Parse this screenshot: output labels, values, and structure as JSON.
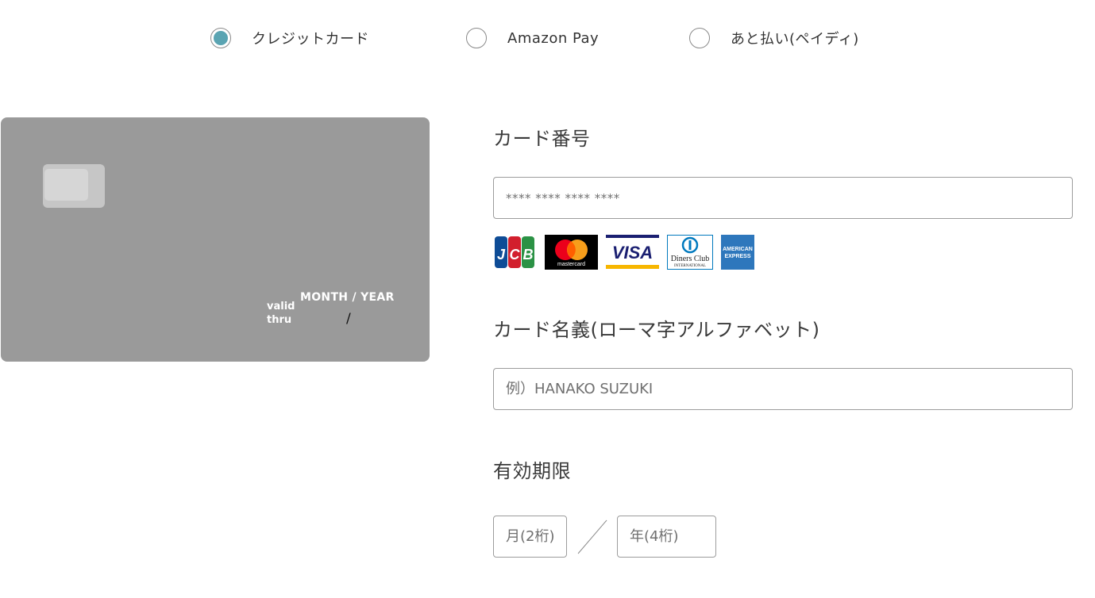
{
  "payment_methods": [
    {
      "label": "クレジットカード",
      "selected": true
    },
    {
      "label": "Amazon Pay",
      "selected": false
    },
    {
      "label": "あと払い(ペイディ)",
      "selected": false
    }
  ],
  "card_preview": {
    "valid_line1": "valid",
    "valid_line2": "thru",
    "expiry_caption": "MONTH / YEAR",
    "expiry_separator": "/"
  },
  "card_number": {
    "label": "カード番号",
    "placeholder": "**** **** **** ****"
  },
  "brands": [
    {
      "name": "JCB",
      "icon": "jcb-logo"
    },
    {
      "name": "mastercard",
      "icon": "mastercard-logo"
    },
    {
      "name": "VISA",
      "icon": "visa-logo"
    },
    {
      "name": "Diners Club",
      "sub": "INTERNATIONAL",
      "icon": "diners-club-logo"
    },
    {
      "name": "AMERICAN",
      "sub": "EXPRESS",
      "icon": "amex-logo"
    }
  ],
  "card_holder": {
    "label": "カード名義(ローマ字アルファベット)",
    "placeholder": "例）HANAKO SUZUKI"
  },
  "expiry": {
    "label": "有効期限",
    "month_placeholder": "月(2桁)",
    "year_placeholder": "年(4桁)"
  },
  "colors": {
    "accent": "#5aa4b2",
    "card_bg": "#9a9a9a",
    "border": "#9c9c9c"
  }
}
